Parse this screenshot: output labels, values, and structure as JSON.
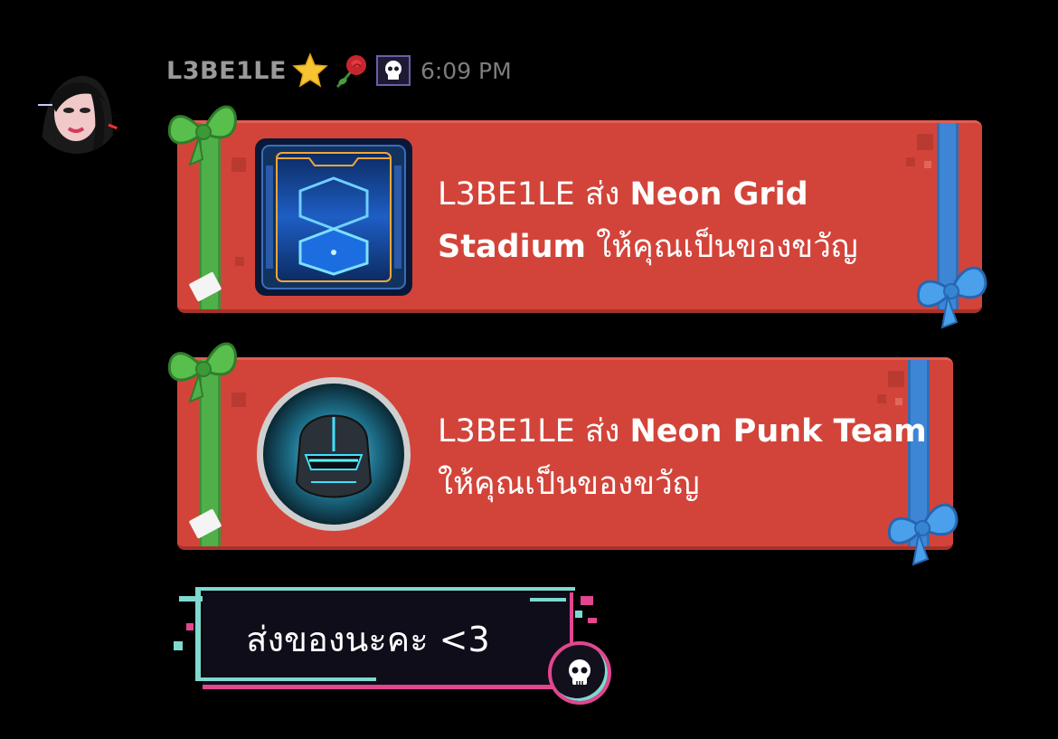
{
  "message": {
    "username": "L3BE1LE",
    "badges": [
      "star-icon",
      "rose-icon",
      "skull-icon"
    ],
    "timestamp": "6:09 PM"
  },
  "gifts": [
    {
      "sender": "L3BE1LE",
      "verb": " ส่ง ",
      "item_name": "Neon Grid Stadium",
      "suffix": " ให้คุณเป็นของขวัญ",
      "icon": "stadium-card-icon"
    },
    {
      "sender": "L3BE1LE",
      "verb": " ส่ง ",
      "item_name": "Neon Punk Team",
      "suffix": " ให้คุณเป็นของขวัญ",
      "icon": "neon-helmet-icon"
    }
  ],
  "bubble": {
    "text": "ส่งของนะคะ <3",
    "icon": "skull-icon"
  },
  "colors": {
    "card_red": "#d2443a",
    "ribbon_green": "#4fb04a",
    "ribbon_blue": "#3d86d6",
    "glitch_cyan": "#7fd9d0",
    "glitch_pink": "#e2468f"
  }
}
